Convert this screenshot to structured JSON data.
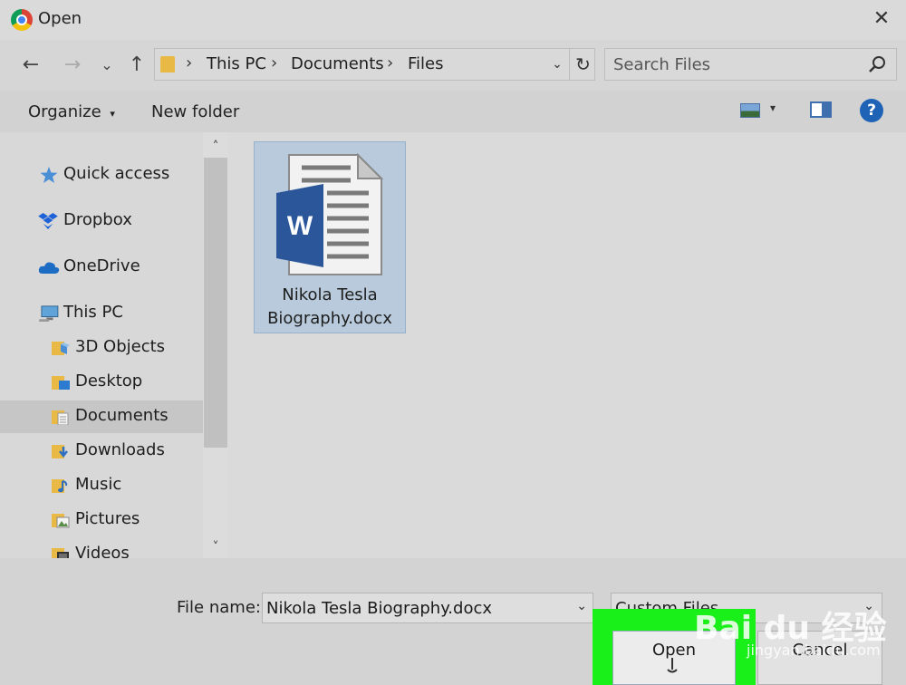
{
  "window": {
    "title": "Open",
    "close_symbol": "✕"
  },
  "nav": {
    "back": "←",
    "forward": "→",
    "recent": "⌄",
    "up": "↑",
    "breadcrumbs": [
      "This PC",
      "Documents",
      "Files"
    ],
    "separator": "›",
    "dropdown": "⌄",
    "refresh": "↻",
    "search_placeholder": "Search Files"
  },
  "toolbar": {
    "organize": "Organize",
    "organize_caret": "▾",
    "new_folder": "New folder",
    "view_caret": "▾",
    "help": "?"
  },
  "sidebar": {
    "items": [
      {
        "label": "Quick access",
        "icon": "star-icon"
      },
      {
        "label": "Dropbox",
        "icon": "dropbox-icon"
      },
      {
        "label": "OneDrive",
        "icon": "cloud-icon"
      },
      {
        "label": "This PC",
        "icon": "computer-icon"
      },
      {
        "label": "3D Objects",
        "icon": "folder-3d-icon"
      },
      {
        "label": "Desktop",
        "icon": "desktop-folder-icon"
      },
      {
        "label": "Documents",
        "icon": "documents-folder-icon",
        "selected": true
      },
      {
        "label": "Downloads",
        "icon": "downloads-folder-icon"
      },
      {
        "label": "Music",
        "icon": "music-folder-icon"
      },
      {
        "label": "Pictures",
        "icon": "pictures-folder-icon"
      },
      {
        "label": "Videos",
        "icon": "videos-folder-icon"
      }
    ],
    "scroll_up": "˄",
    "scroll_down": "˅"
  },
  "files": [
    {
      "name_line1": "Nikola Tesla",
      "name_line2": "Biography.docx",
      "icon": "word-document-icon",
      "selected": true
    }
  ],
  "footer": {
    "file_name_label": "File name:",
    "file_name_value": "Nikola Tesla Biography.docx",
    "file_type_value": "Custom Files",
    "dropdown": "⌄",
    "open_label": "Open",
    "cancel_label": "Cancel"
  },
  "watermark": {
    "text": "Bai du 经验",
    "sub": "jingyan.baidu.com"
  },
  "colors": {
    "highlight": "#19ef19",
    "selection": "#b8cadb",
    "word_blue": "#2b579a",
    "help_blue": "#1f63b6"
  }
}
